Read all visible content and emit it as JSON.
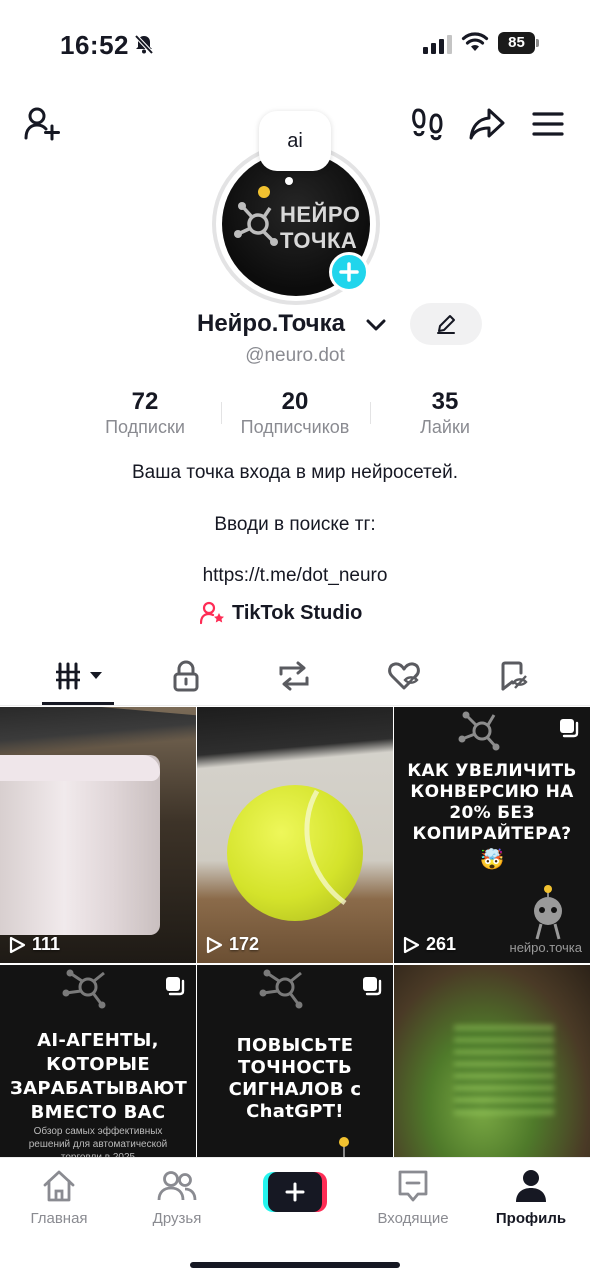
{
  "status_bar": {
    "time": "16:52",
    "battery": "85"
  },
  "profile": {
    "bubble_text": "ai",
    "avatar_text_line1": "НЕЙРО",
    "avatar_text_line2": "ТОЧКА",
    "name": "Нейро.Точка",
    "handle": "@neuro.dot"
  },
  "stats": [
    {
      "value": "72",
      "label": "Подписки"
    },
    {
      "value": "20",
      "label": "Подписчиков"
    },
    {
      "value": "35",
      "label": "Лайки"
    }
  ],
  "bio": {
    "line1": "Ваша точка входа в мир нейросетей.",
    "line2": "Вводи в поиске тг:",
    "line3": "https://t.me/dot_neuro"
  },
  "studio_label": "TikTok Studio",
  "videos": [
    {
      "views": "111"
    },
    {
      "views": "172"
    },
    {
      "views": "261",
      "title": "КАК УВЕЛИЧИТЬ КОНВЕРСИЮ НА 20% БЕЗ КОПИРАЙТЕРА?",
      "emoji": "🤯",
      "watermark": "нейро.точка"
    },
    {
      "title": "AI-АГЕНТЫ, КОТОРЫЕ ЗАРАБАТЫВАЮТ ВМЕСТО ВАС",
      "subtitle": "Обзор самых эффективных решений для автоматической торговли в 2025"
    },
    {
      "title": "ПОВЫСЬТЕ ТОЧНОСТЬ СИГНАЛОВ с ChatGPT!"
    },
    {}
  ],
  "nav": {
    "home": "Главная",
    "friends": "Друзья",
    "inbox": "Входящие",
    "profile": "Профиль"
  },
  "colors": {
    "accent_cyan": "#20d5ec",
    "accent_pink": "#fe2c55",
    "text": "#161823",
    "muted": "#8a8b91"
  }
}
